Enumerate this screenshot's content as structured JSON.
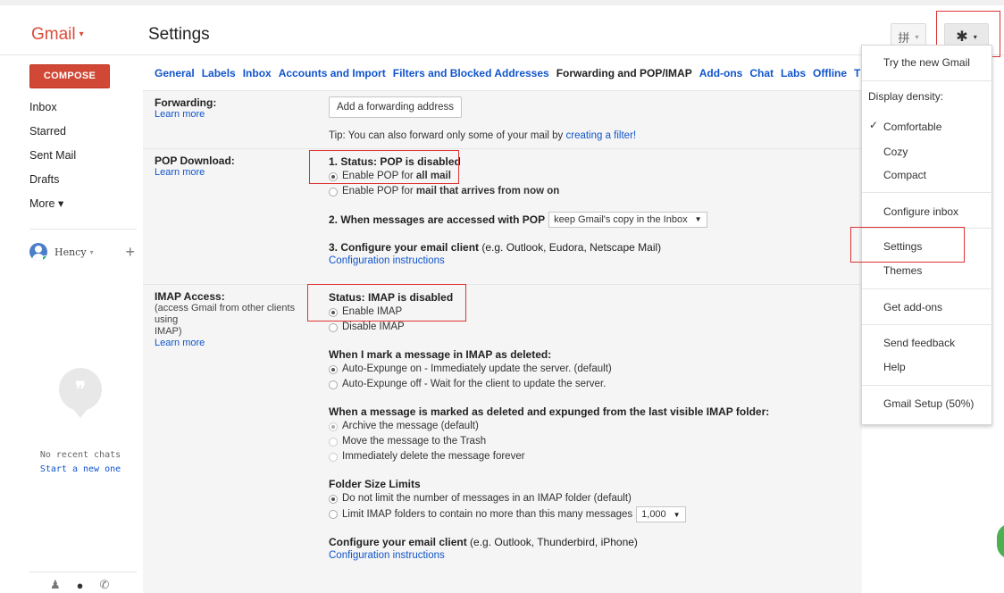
{
  "header": {
    "app_name": "Gmail",
    "app_caret": "▾",
    "page_title": "Settings",
    "input_tools_icon": "input-tools-icon",
    "input_tools_glyph": "拼",
    "gear_glyph": "✱"
  },
  "sidebar": {
    "compose_label": "COMPOSE",
    "items": [
      {
        "label": "Inbox"
      },
      {
        "label": "Starred"
      },
      {
        "label": "Sent Mail"
      },
      {
        "label": "Drafts"
      },
      {
        "label": "More ▾"
      }
    ],
    "user_name": "Hency",
    "user_caret": "▾",
    "add_label": "+",
    "no_chats_text": "No recent chats",
    "start_chat_text": "Start a new one"
  },
  "tabs": [
    {
      "label": "General"
    },
    {
      "label": "Labels"
    },
    {
      "label": "Inbox"
    },
    {
      "label": "Accounts and Import"
    },
    {
      "label": "Filters and Blocked Addresses"
    },
    {
      "label": "Forwarding and POP/IMAP",
      "active": true
    },
    {
      "label": "Add-ons"
    },
    {
      "label": "Chat"
    },
    {
      "label": "Labs"
    },
    {
      "label": "Offline"
    },
    {
      "label": "Themes"
    }
  ],
  "forwarding": {
    "title": "Forwarding:",
    "learn_more": "Learn more",
    "add_button": "Add a forwarding address",
    "tip_prefix": "Tip: You can also forward only some of your mail by ",
    "tip_link": "creating a filter!"
  },
  "pop": {
    "title": "POP Download:",
    "learn_more": "Learn more",
    "status": "1. Status: POP is disabled",
    "opt1_prefix": "Enable POP for ",
    "opt1_bold": "all mail",
    "opt2_prefix": "Enable POP for ",
    "opt2_bold": "mail that arrives from now on",
    "when_label": "2. When messages are accessed with POP",
    "when_value": "keep Gmail's copy in the Inbox",
    "configure_bold": "3. Configure your email client",
    "configure_rest": " (e.g. Outlook, Eudora, Netscape Mail)",
    "config_link": "Configuration instructions"
  },
  "imap": {
    "title": "IMAP Access:",
    "desc_line1": "(access Gmail from other clients using",
    "desc_line2": "IMAP)",
    "learn_more": "Learn more",
    "status": "Status: IMAP is disabled",
    "enable": "Enable IMAP",
    "disable": "Disable IMAP",
    "deleted_title": "When I mark a message in IMAP as deleted:",
    "deleted_opt1": "Auto-Expunge on - Immediately update the server. (default)",
    "deleted_opt2": "Auto-Expunge off - Wait for the client to update the server.",
    "expunged_title": "When a message is marked as deleted and expunged from the last visible IMAP folder:",
    "expunged_opt1": "Archive the message (default)",
    "expunged_opt2": "Move the message to the Trash",
    "expunged_opt3": "Immediately delete the message forever",
    "folder_title": "Folder Size Limits",
    "folder_opt1": "Do not limit the number of messages in an IMAP folder (default)",
    "folder_opt2": "Limit IMAP folders to contain no more than this many messages",
    "folder_limit_value": "1,000",
    "configure_bold": "Configure your email client",
    "configure_rest": " (e.g. Outlook, Thunderbird, iPhone)",
    "config_link": "Configuration instructions"
  },
  "settings_menu": {
    "try_new": "Try the new Gmail",
    "display_density": "Display density:",
    "comfortable": "Comfortable",
    "cozy": "Cozy",
    "compact": "Compact",
    "configure_inbox": "Configure inbox",
    "settings": "Settings",
    "themes": "Themes",
    "get_addons": "Get add-ons",
    "send_feedback": "Send feedback",
    "help": "Help",
    "gmail_setup": "Gmail Setup (50%)",
    "checkmark": "✓"
  },
  "colors": {
    "brand": "#dd4b39",
    "compose": "#d14836",
    "link": "#1155cc",
    "highlight_box": "#dd3333"
  }
}
